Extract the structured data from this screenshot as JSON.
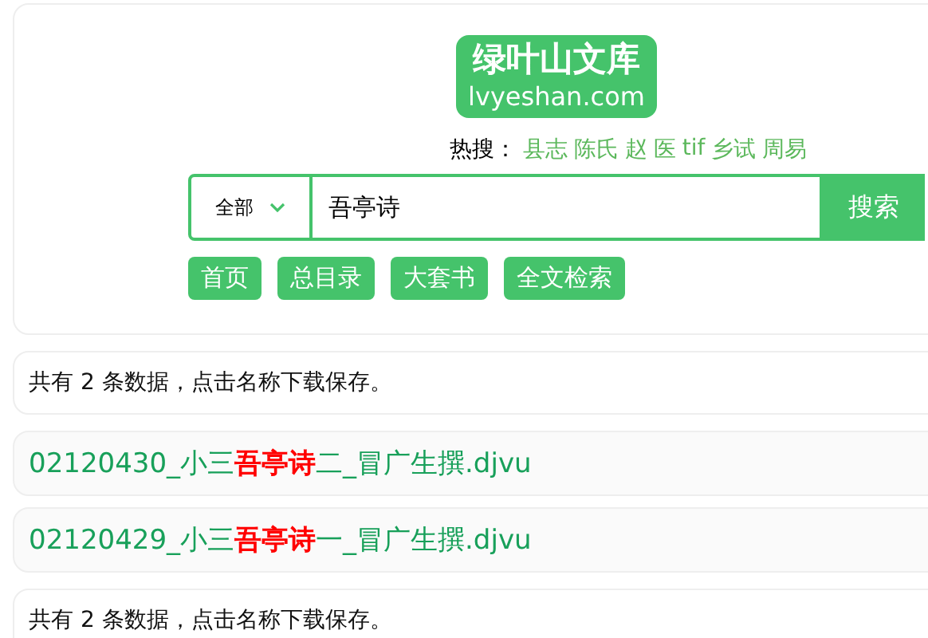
{
  "logo": {
    "title": "绿叶山文库",
    "domain": "lvyeshan.com"
  },
  "hot_search": {
    "label": "热搜：",
    "terms": [
      "县志",
      "陈氏",
      "赵",
      "医",
      "tif",
      "乡试",
      "周易"
    ]
  },
  "search": {
    "scope": "全部",
    "value": "吾亭诗",
    "button": "搜索"
  },
  "nav": [
    "首页",
    "总目录",
    "大套书",
    "全文检索"
  ],
  "summary_top": "共有 2 条数据，点击名称下载保存。",
  "results": [
    "02120430_小三**吾亭诗**二_冒广生撰.djvu",
    "02120429_小三**吾亭诗**一_冒广生撰.djvu"
  ],
  "summary_bottom": "共有 2 条数据，点击名称下载保存。"
}
